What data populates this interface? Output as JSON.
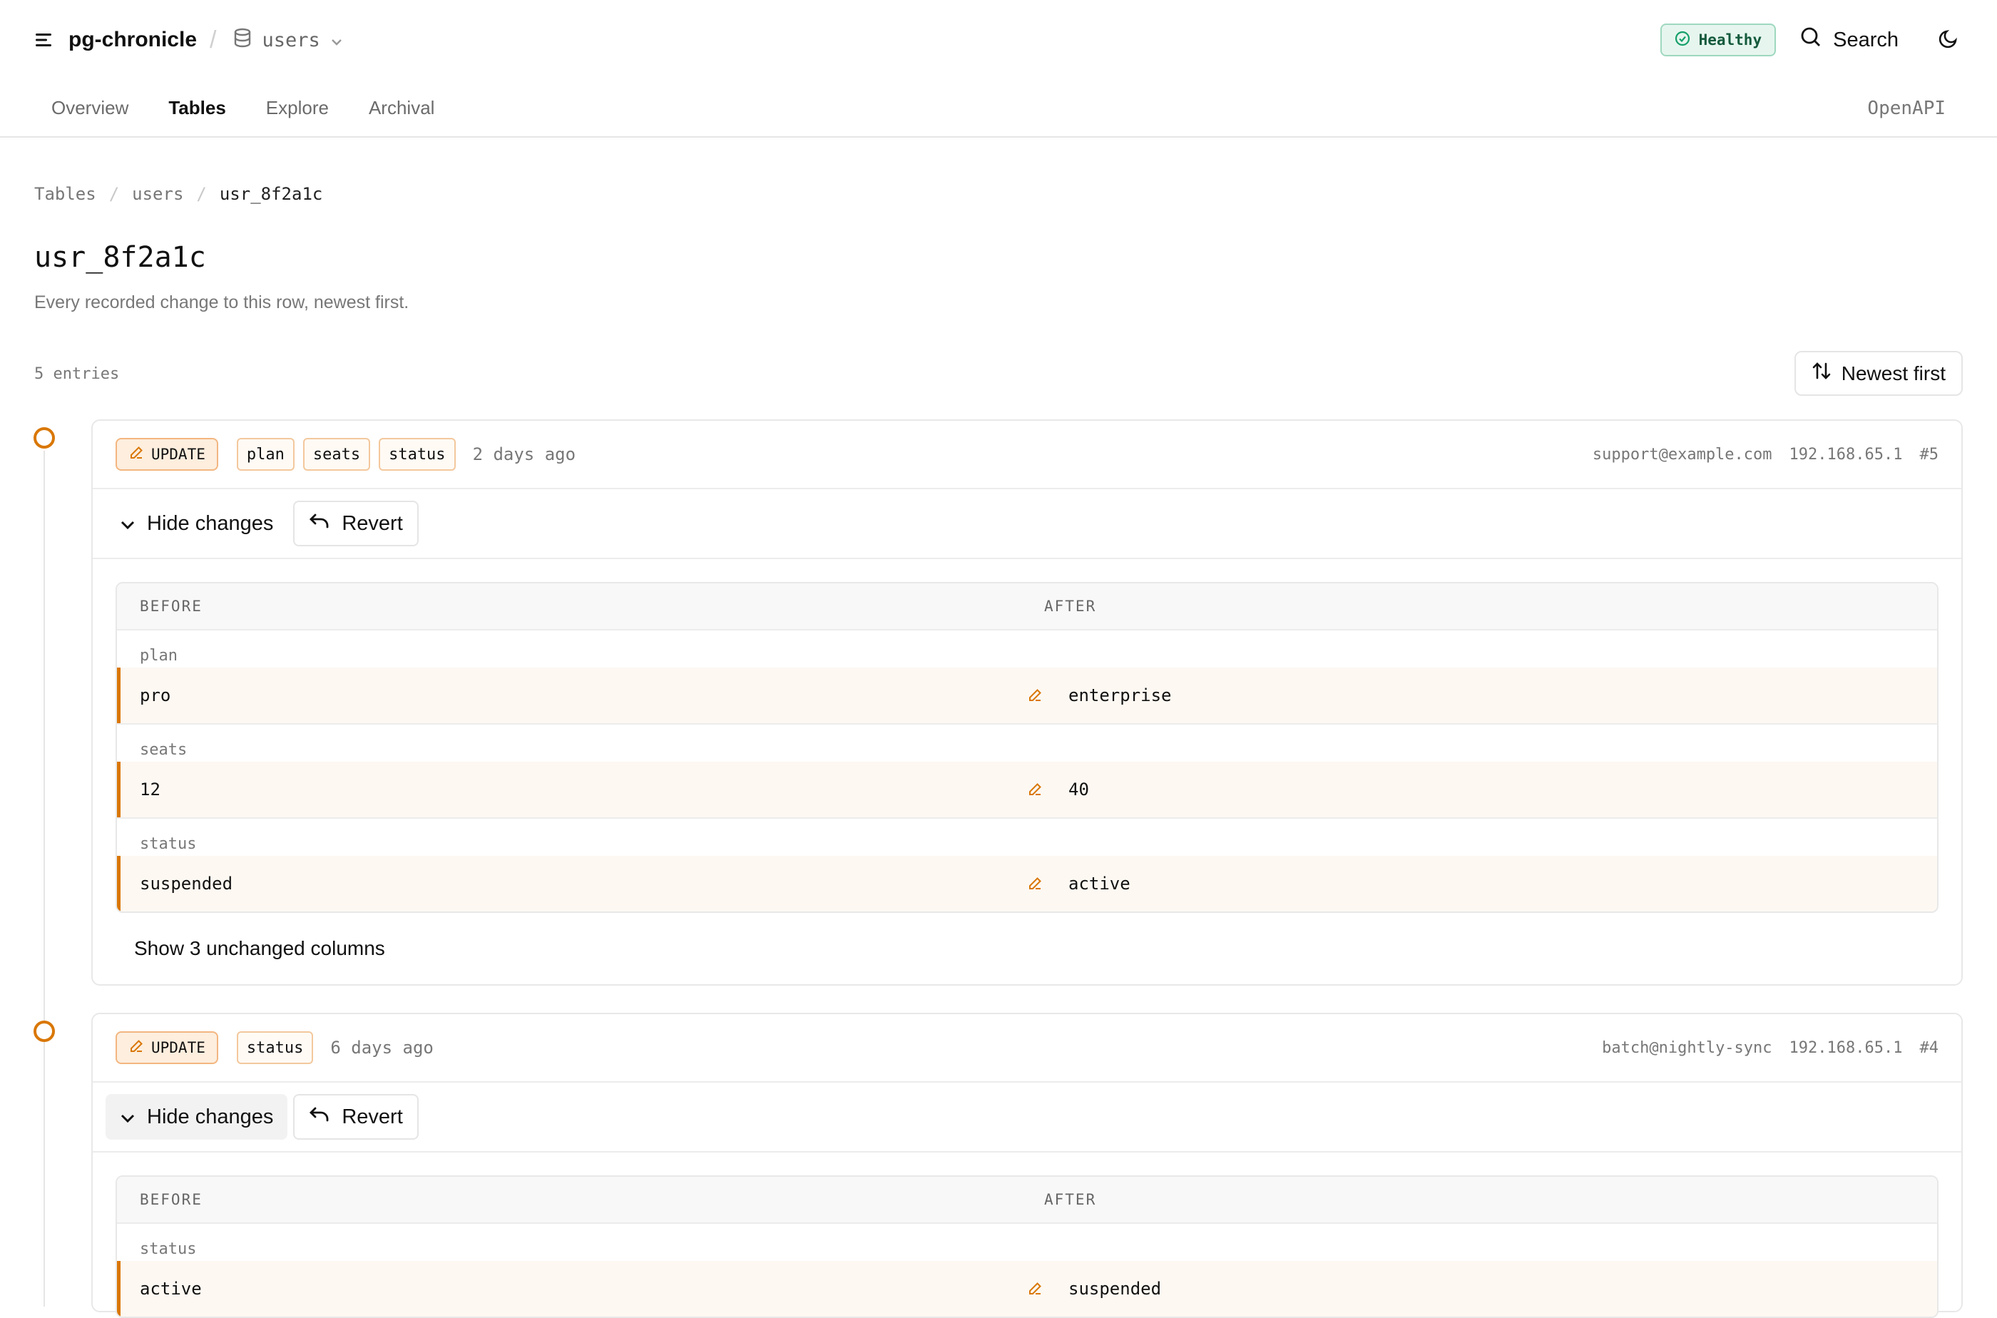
{
  "header": {
    "app_name": "pg-chronicle",
    "db_name": "users",
    "health": "Healthy",
    "search_label": "Search"
  },
  "nav": {
    "tabs": [
      {
        "label": "Overview",
        "active": false
      },
      {
        "label": "Tables",
        "active": true
      },
      {
        "label": "Explore",
        "active": false
      },
      {
        "label": "Archival",
        "active": false
      }
    ],
    "openapi": "OpenAPI"
  },
  "breadcrumb": [
    "Tables",
    "users",
    "usr_8f2a1c"
  ],
  "page": {
    "title": "usr_8f2a1c",
    "subtitle": "Every recorded change to this row, newest first.",
    "count": "5 entries",
    "sort_label": "Newest first"
  },
  "entries": [
    {
      "op": "UPDATE",
      "columns": [
        "plan",
        "seats",
        "status"
      ],
      "time": "2 days ago",
      "user": "support@example.com",
      "ip": "192.168.65.1",
      "id": "#5",
      "hide_label": "Hide changes",
      "revert_label": "Revert",
      "before_header": "BEFORE",
      "after_header": "AFTER",
      "changes": [
        {
          "field": "plan",
          "before": "pro",
          "after": "enterprise"
        },
        {
          "field": "seats",
          "before": "12",
          "after": "40"
        },
        {
          "field": "status",
          "before": "suspended",
          "after": "active"
        }
      ],
      "show_unchanged": "Show 3 unchanged columns"
    },
    {
      "op": "UPDATE",
      "columns": [
        "status"
      ],
      "time": "6 days ago",
      "user": "batch@nightly-sync",
      "ip": "192.168.65.1",
      "id": "#4",
      "hide_label": "Hide changes",
      "revert_label": "Revert",
      "before_header": "BEFORE",
      "after_header": "AFTER",
      "changes": [
        {
          "field": "status",
          "before": "active",
          "after": "suspended"
        }
      ]
    }
  ],
  "colors": {
    "accent": "#d97706",
    "healthy_bg": "#e6f6ef",
    "healthy_border": "#9fd8bf",
    "update_bg": "#fdeede",
    "diff_row_bg": "#fdf8f2"
  },
  "icons": [
    "menu-icon",
    "database-icon",
    "chevron-down-icon",
    "check-circle-icon",
    "search-icon",
    "moon-icon",
    "sort-icon",
    "pencil-icon",
    "undo-icon"
  ]
}
